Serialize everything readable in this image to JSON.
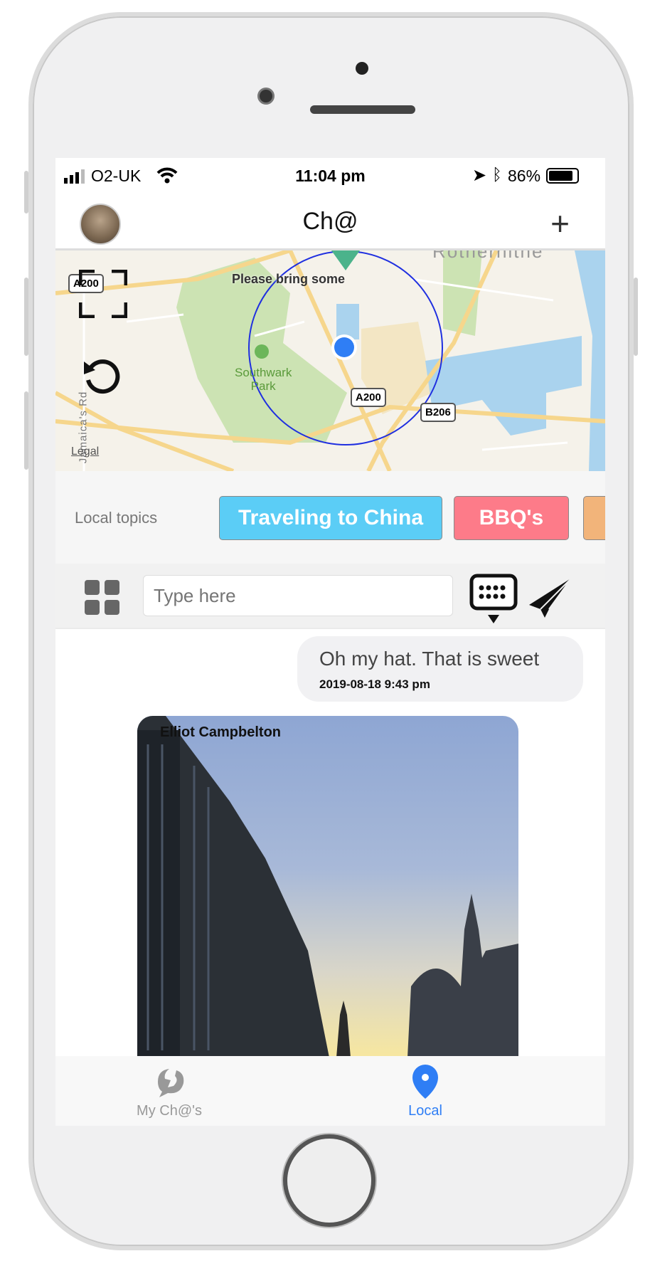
{
  "status_bar": {
    "carrier": "O2-UK",
    "time": "11:04 pm",
    "battery": "86%",
    "battery_level": 0.86
  },
  "header": {
    "title": "Ch@",
    "add_icon": "plus-icon"
  },
  "map": {
    "pin_label": "Please bring some",
    "park_label": "Southwark",
    "park_label2": "Park",
    "roads": [
      "A200",
      "A200",
      "B206"
    ],
    "legal": "Legal",
    "street": "Jamaica's Rd",
    "area": "Rotherhithe"
  },
  "topics": {
    "label": "Local topics",
    "items": [
      {
        "label": "Traveling to China",
        "color": "#5bcdf6"
      },
      {
        "label": "BBQ's",
        "color": "#fd7b89"
      },
      {
        "label": "",
        "color": "#f2b47a"
      }
    ]
  },
  "composer": {
    "placeholder": "Type here"
  },
  "messages": [
    {
      "text": "Oh my hat. That is sweet",
      "time": "2019-08-18 9:43 pm"
    },
    {
      "author": "Elliot Campbelton"
    }
  ],
  "tabs": [
    {
      "label": "My Ch@'s",
      "color": "#999999"
    },
    {
      "label": "Local",
      "color": "#2f7ef5"
    }
  ]
}
